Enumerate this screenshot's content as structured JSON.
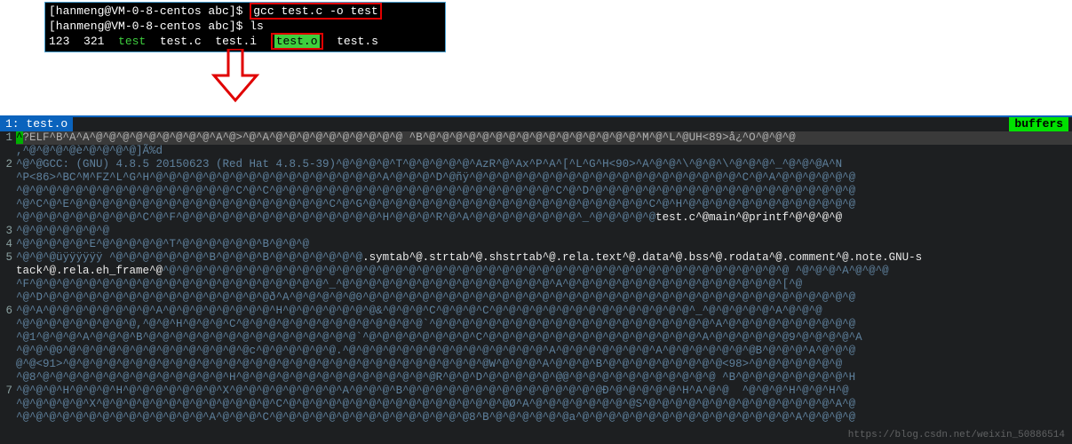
{
  "terminal": {
    "prompt1": "[hanmeng@VM-0-8-centos abc]$ ",
    "cmd1": "gcc test.c -o test",
    "prompt2": "[hanmeng@VM-0-8-centos abc]$ ",
    "cmd2": "ls",
    "ls_items": {
      "a": "123",
      "b": "321",
      "test": "test",
      "testc": "test.c",
      "testi": "test.i",
      "testo": "test.o",
      "tests": "test.s"
    }
  },
  "editor": {
    "tab_label": "1: test.o",
    "buffers_label": "buffers",
    "lines": [
      {
        "num": "1",
        "cursor": "^",
        "text": "?ELF^B^A^A^@^@^@^@^@^@^@^@^@^A^@>^@^A^@^@^@^@^@^@^@^@^@^@ ^B^@^@^@^@^@^@^@^@^@^@^@^@^@^@^@^@^M^@^L^@UH<89>å¿^O^@^@^@"
      },
      {
        "num": "",
        "text": ",^@^@^@^@è^@^@^@^@]Ã%d"
      },
      {
        "num": "2",
        "text": "^@^@GCC: (GNU) 4.8.5 20150623 (Red Hat 4.8.5-39)^@^@^@^@^T^@^@^@^@^@^AzR^@^Ax^P^A^[^L^G^H<90>^A^@^@^\\^@^@^\\^@^@^@^_^@^@^@A^N"
      },
      {
        "num": "",
        "text": "^P<86>^BC^M^FZ^L^G^H^@^@^@^@^@^@^@^@^@^@^@^@^@^@^@^@^@^A^@^@^@^D^@ñÿ^@^@^@^@^@^@^@^@^@^@^@^@^@^@^@^@^@^@^@^@^C^@^A^@^@^@^@^@^@"
      },
      {
        "num": "",
        "text": "^@^@^@^@^@^@^@^@^@^@^@^@^@^@^@^@^C^@^C^@^@^@^@^@^@^@^@^@^@^@^@^@^@^@^@^@^@^@^@^@^C^@^D^@^@^@^@^@^@^@^@^@^@^@^@^@^@^@^@^@^@^@^@"
      },
      {
        "num": "",
        "text": "^@^C^@^E^@^@^@^@^@^@^@^@^@^@^@^@^@^@^@^@^@^@^@^C^@^G^@^@^@^@^@^@^@^@^@^@^@^@^@^@^@^@^@^@^@^@^@^C^@^H^@^@^@^@^@^@^@^@^@^@^@^@^@"
      },
      {
        "num": "",
        "suffix": "test.c^@main^@printf^@^@^@^@",
        "text": "^@^@^@^@^@^@^@^@^@^C^@^F^@^@^@^@^@^@^@^@^@^@^@^@^@^@^@^H^@^@^@^R^@^A^@^@^@^@^@^@^@^@^_^@^@^@^@^@"
      },
      {
        "num": "3",
        "text": "^@^@^@^@^@^@^@"
      },
      {
        "num": "4",
        "text": "^@^@^@^@^@^E^@^@^@^@^@^T^@^@^@^@^@^@^B^@^@^@"
      },
      {
        "num": "5",
        "suffix": ".symtab^@.strtab^@.shstrtab^@.rela.text^@.data^@.bss^@.rodata^@.comment^@.note.GNU-s",
        "text": "^@^@^@üÿÿÿÿÿÿ ^@^@^@^@^@^@^@^B^@^@^@^B^@^@^@^@^@^@^@"
      },
      {
        "num": "",
        "suffix2": "tack^@.rela.eh_frame^@",
        "text": "^@^@^@^@^@^@^@^@^@^@^@^@^@^@^@^@^@^@^@^@^@^@^@^@^@^@^@^@^@^@^@^@^@^@^@^@^@^@^@^@^@^@^@^@^@^@^@ ^@^@^@^A^@^@^@"
      },
      {
        "num": "",
        "text": "^F^@^@^@^@^@^@^@^@^@^@^@^@^@^@^@^@^@^@^@^@^@^@^_^@^@^@^@^@^@^@^@^@^@^@^@^@^@^@^@^A^@^@^@^@^@^@^@^@^@^@^@^@^@^@^@^@^[^@"
      },
      {
        "num": "",
        "text": "^@^D^@^@^@^@^@^@^@^@^@^@^@^@^@^@^@^@^@ð^A^@^@^@^@^@0^@^@^@^@^@^@^@^@^@^@^@^@^@^@^@^@^@^@^@^@^@^@^@^@^@^@^@^@^@^@^@^@^@^@^@^@^@"
      },
      {
        "num": "6",
        "text": "^@^A^@^@^@^@^@^@^@^@^A^@^@^@^@^@^@^@^@^H^@^@^@^@^@^@^@&^@^@^@^C^@^@^@^C^@^@^@^@^@^@^@^@^@^@^@^@^@^@^@^_^@^@^@^@^@^A^@^@^@"
      },
      {
        "num": "",
        "text": "^@^@^@^@^@^@^@^@^@,^@^@^H^@^@^@^C^@^@^@^@^@^@^@^@^@^@^@^@^@^@`^@^@^@^@^@^@^@^@^@^@^@^@^@^@^@^@^@^@^@^@^@^A^@^@^@^@^@^@^@^@^@^@"
      },
      {
        "num": "",
        "text": "^@1^@^@^@^A^@^@^@^B^@^@^@^@^@^@^@^@^@^@^@^@^@^@^@^@`^@^@^@^@^@^@^@^@^C^@^@^@^@^@^@^@^@^@^@^@^@^@^@^@^@^A^@^@^@^@^@^@9^@^@^@^@^A"
      },
      {
        "num": "",
        "text": "^@^@^@0^@^@^@^@^@^@^@^@^@^@^@^@^@^@c^@^@^@^@^@^@.^@^@^@^@^@^@^@^@^@^@^@^@^@^@^@^A^@^@^@^@^@^@^@^A^@^@^@^@^@^@^@B^@^@^@^A^@^@^@"
      },
      {
        "num": "",
        "text": "@^@<91>^@^@^@^@^@^@^@^@^@^@^@^@^@^@^@^@^@^@^@^@^@^@^@^@^@^@^@^@^@^@^@^@W^@^@^@^A^@^@^@^B^@^@^@^@^@^@^@^@^@<98>^@^@^@^@^@^@^@"
      },
      {
        "num": "",
        "text": "^@8^@^@^@^@^@^@^@^@^@^@^@^@^@^@^H^@^@^@^@^@^@^@^@^@^@^@^@^@^@^@R^@^@^D^@^@^@^@^@^@@^@^@^@^@^@^@^@^@^@^@^@ ^B^@^@^@^@^@^@^@^@^H"
      },
      {
        "num": "7",
        "text": "^@^@^@^H^@^@^@^H^@^@^@^@^@^@^@^X^@^@^@^@^@^@^@^@^A^@^@^@^B^@^@^@^@^@^@^@^@^@^@^@^@^@^@^@Ð^@^@^@^@^@^H^A^@^@  ^@^@^@^H^@^@^H^@"
      },
      {
        "num": "",
        "text": "^@^@^@^@^@^X^@^@^@^@^@^@^@^@^@^@^@^@^@^C^@^@^@^@^@^@^@^@^@^@^@^@^@^@^@^@^@Ø^A^@^@^@^@^@^@^@^@S^@^@^@^@^@^@^@^@^@^@^@^@^@^@^A^@"
      },
      {
        "num": "",
        "text": "^@^@^@^@^@^@^@^@^@^@^@^@^@^@^A^@^@^@^C^@^@^@^@^@^@^@^@^@^@^@^@^@^@^@8^B^@^@^@^@^@^@a^@^@^@^@^@^@^@^@^@^@^@^@^@^@^@^@^A^@^@^@^@"
      }
    ]
  },
  "watermark": "https://blog.csdn.net/weixin_50886514"
}
